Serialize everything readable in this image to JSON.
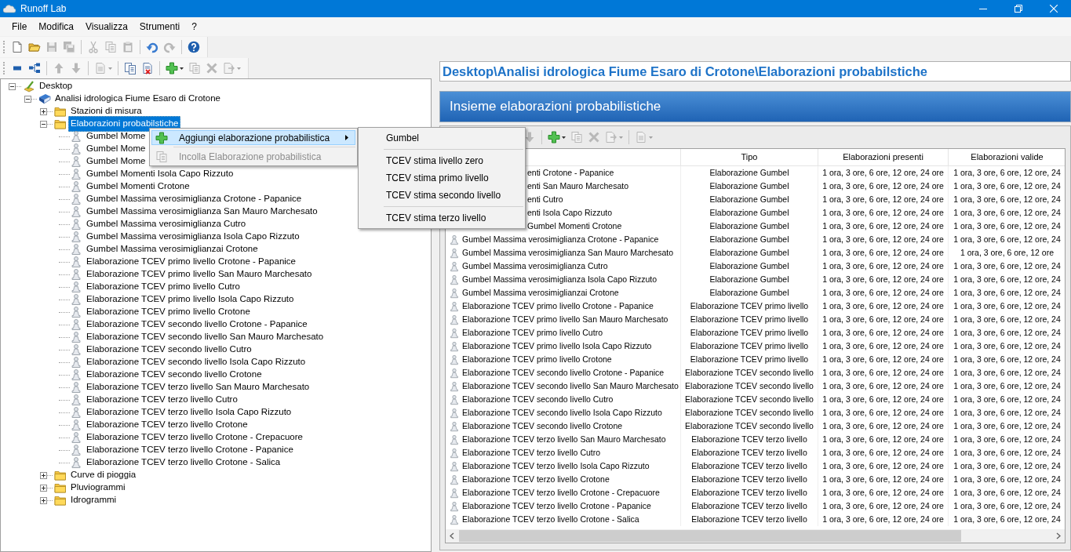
{
  "window": {
    "title": "Runoff Lab"
  },
  "menu_bar": [
    "File",
    "Modifica",
    "Visualizza",
    "Strumenti",
    "?"
  ],
  "main_toolbar": [
    {
      "kind": "new",
      "disabled": false
    },
    {
      "kind": "open",
      "disabled": false
    },
    {
      "kind": "save",
      "disabled": true
    },
    {
      "kind": "saveall",
      "disabled": true
    },
    {
      "kind": "separator"
    },
    {
      "kind": "cut",
      "disabled": true
    },
    {
      "kind": "copy",
      "disabled": true
    },
    {
      "kind": "paste",
      "disabled": true
    },
    {
      "kind": "separator"
    },
    {
      "kind": "undo",
      "disabled": false
    },
    {
      "kind": "redo",
      "disabled": true
    },
    {
      "kind": "separator"
    },
    {
      "kind": "help",
      "disabled": false
    }
  ],
  "tree_toolbar": [
    {
      "kind": "rect",
      "disabled": false
    },
    {
      "kind": "tree",
      "disabled": false
    },
    {
      "kind": "separator"
    },
    {
      "kind": "up",
      "disabled": true
    },
    {
      "kind": "down",
      "disabled": true
    },
    {
      "kind": "separator"
    },
    {
      "kind": "doc",
      "disabled": true,
      "dropdown": true
    },
    {
      "kind": "separator"
    },
    {
      "kind": "copydoc",
      "disabled": false
    },
    {
      "kind": "deletedoc",
      "disabled": false
    },
    {
      "kind": "separator"
    },
    {
      "kind": "add",
      "disabled": false,
      "dropdown": true
    },
    {
      "kind": "copy",
      "disabled": true
    },
    {
      "kind": "delete",
      "disabled": true
    },
    {
      "kind": "export",
      "disabled": true,
      "dropdown": true
    }
  ],
  "tree": [
    {
      "label": "Desktop",
      "kind": "desktop",
      "expanded": true,
      "selected": false,
      "children": [
        {
          "label": "Analisi idrologica Fiume Esaro di Crotone",
          "kind": "project",
          "expanded": true,
          "selected": false,
          "children": [
            {
              "label": "Stazioni di misura",
              "kind": "folder",
              "expanded": false,
              "selected": false
            },
            {
              "label": "Elaborazioni probabilstiche",
              "kind": "folder",
              "expanded": true,
              "selected": true,
              "children": [
                {
                  "label": "Gumbel Mome",
                  "kind": "leaf",
                  "selected": false
                },
                {
                  "label": "Gumbel Mome",
                  "kind": "leaf",
                  "selected": false
                },
                {
                  "label": "Gumbel Mome",
                  "kind": "leaf",
                  "selected": false
                },
                {
                  "label": "Gumbel Momenti Isola Capo Rizzuto",
                  "kind": "leaf",
                  "selected": false
                },
                {
                  "label": "Gumbel Momenti Crotone",
                  "kind": "leaf",
                  "selected": false
                },
                {
                  "label": "Gumbel Massima verosimiglianza Crotone - Papanice",
                  "kind": "leaf",
                  "selected": false
                },
                {
                  "label": "Gumbel Massima verosimiglianza San Mauro Marchesato",
                  "kind": "leaf",
                  "selected": false
                },
                {
                  "label": "Gumbel Massima verosimiglianza Cutro",
                  "kind": "leaf",
                  "selected": false
                },
                {
                  "label": "Gumbel Massima verosimiglianza Isola Capo Rizzuto",
                  "kind": "leaf",
                  "selected": false
                },
                {
                  "label": "Gumbel Massima verosimiglianzai Crotone",
                  "kind": "leaf",
                  "selected": false
                },
                {
                  "label": "Elaborazione TCEV primo livello Crotone - Papanice",
                  "kind": "leaf",
                  "selected": false
                },
                {
                  "label": "Elaborazione TCEV primo livello San Mauro Marchesato",
                  "kind": "leaf",
                  "selected": false
                },
                {
                  "label": "Elaborazione TCEV primo livello Cutro",
                  "kind": "leaf",
                  "selected": false
                },
                {
                  "label": "Elaborazione TCEV primo livello Isola Capo Rizzuto",
                  "kind": "leaf",
                  "selected": false
                },
                {
                  "label": "Elaborazione TCEV primo livello Crotone",
                  "kind": "leaf",
                  "selected": false
                },
                {
                  "label": "Elaborazione TCEV secondo livello Crotone - Papanice",
                  "kind": "leaf",
                  "selected": false
                },
                {
                  "label": "Elaborazione TCEV secondo livello San Mauro Marchesato",
                  "kind": "leaf",
                  "selected": false
                },
                {
                  "label": "Elaborazione TCEV secondo livello Cutro",
                  "kind": "leaf",
                  "selected": false
                },
                {
                  "label": "Elaborazione TCEV secondo livello Isola Capo Rizzuto",
                  "kind": "leaf",
                  "selected": false
                },
                {
                  "label": "Elaborazione TCEV secondo livello Crotone",
                  "kind": "leaf",
                  "selected": false
                },
                {
                  "label": "Elaborazione TCEV terzo livello San Mauro Marchesato",
                  "kind": "leaf",
                  "selected": false
                },
                {
                  "label": "Elaborazione TCEV terzo livello Cutro",
                  "kind": "leaf",
                  "selected": false
                },
                {
                  "label": "Elaborazione TCEV terzo livello Isola Capo Rizzuto",
                  "kind": "leaf",
                  "selected": false
                },
                {
                  "label": "Elaborazione TCEV terzo livello Crotone",
                  "kind": "leaf",
                  "selected": false
                },
                {
                  "label": "Elaborazione TCEV terzo livello Crotone - Crepacuore",
                  "kind": "leaf",
                  "selected": false
                },
                {
                  "label": "Elaborazione TCEV terzo livello Crotone - Papanice",
                  "kind": "leaf",
                  "selected": false
                },
                {
                  "label": "Elaborazione TCEV terzo livello Crotone - Salica",
                  "kind": "leaf",
                  "selected": false
                }
              ]
            },
            {
              "label": "Curve di pioggia",
              "kind": "folder",
              "expanded": false,
              "selected": false
            },
            {
              "label": "Pluviogrammi",
              "kind": "folder",
              "expanded": false,
              "selected": false
            },
            {
              "label": "Idrogrammi",
              "kind": "folder",
              "expanded": false,
              "selected": false
            }
          ]
        }
      ]
    }
  ],
  "context_menu": {
    "items": [
      {
        "label": "Aggiungi elaborazione probabilistica",
        "kind": "submenu",
        "selected": true,
        "disabled": false
      },
      {
        "label": "Incolla Elaborazione probabilistica",
        "kind": "paste",
        "selected": false,
        "disabled": true
      }
    ]
  },
  "submenu": {
    "groups": [
      [
        "Gumbel"
      ],
      [
        "TCEV stima livello zero",
        "TCEV stima primo livello",
        "TCEV stima secondo livello"
      ],
      [
        "TCEV stima terzo livello"
      ]
    ]
  },
  "path_bar": {
    "text": "Desktop\\Analisi idrologica Fiume Esaro di Crotone\\Elaborazioni probabilstiche"
  },
  "panel": {
    "title": "Insieme elaborazioni probabilistiche"
  },
  "panel_toolbar": [
    {
      "kind": "down",
      "disabled": true
    },
    {
      "kind": "separator"
    },
    {
      "kind": "add",
      "disabled": false,
      "dropdown": true
    },
    {
      "kind": "copy",
      "disabled": true
    },
    {
      "kind": "delete",
      "disabled": true
    },
    {
      "kind": "export",
      "disabled": true,
      "dropdown": true
    },
    {
      "kind": "separator"
    },
    {
      "kind": "doc",
      "disabled": true,
      "dropdown": true
    }
  ],
  "table": {
    "headers": [
      "Tipo",
      "Elaborazioni presenti",
      "Elaborazioni valide"
    ],
    "rows": [
      {
        "name": "enti Crotone - Papanice",
        "type": "Elaborazione Gumbel",
        "present": "1 ora, 3 ore, 6 ore, 12 ore, 24 ore",
        "valid": "1 ora, 3 ore, 6 ore, 12 ore, 24"
      },
      {
        "name": "enti San Mauro Marchesato",
        "type": "Elaborazione Gumbel",
        "present": "1 ora, 3 ore, 6 ore, 12 ore, 24 ore",
        "valid": "1 ora, 3 ore, 6 ore, 12 ore, 24"
      },
      {
        "name": "enti Cutro",
        "type": "Elaborazione Gumbel",
        "present": "1 ora, 3 ore, 6 ore, 12 ore, 24 ore",
        "valid": "1 ora, 3 ore, 6 ore, 12 ore, 24"
      },
      {
        "name": "enti Isola Capo Rizzuto",
        "type": "Elaborazione Gumbel",
        "present": "1 ora, 3 ore, 6 ore, 12 ore, 24 ore",
        "valid": "1 ora, 3 ore, 6 ore, 12 ore, 24"
      },
      {
        "name": "Gumbel Momenti Crotone",
        "type": "Elaborazione Gumbel",
        "present": "1 ora, 3 ore, 6 ore, 12 ore, 24 ore",
        "valid": "1 ora, 3 ore, 6 ore, 12 ore, 24"
      },
      {
        "name": "Gumbel Massima verosimiglianza Crotone - Papanice",
        "type": "Elaborazione Gumbel",
        "present": "1 ora, 3 ore, 6 ore, 12 ore, 24 ore",
        "valid": "1 ora, 3 ore, 6 ore, 12 ore, 24"
      },
      {
        "name": "Gumbel Massima verosimiglianza San Mauro Marchesato",
        "type": "Elaborazione Gumbel",
        "present": "1 ora, 3 ore, 6 ore, 12 ore, 24 ore",
        "valid": "1 ora, 3 ore, 6 ore, 12 ore"
      },
      {
        "name": "Gumbel Massima verosimiglianza Cutro",
        "type": "Elaborazione Gumbel",
        "present": "1 ora, 3 ore, 6 ore, 12 ore, 24 ore",
        "valid": "1 ora, 3 ore, 6 ore, 12 ore, 24"
      },
      {
        "name": "Gumbel Massima verosimiglianza Isola Capo Rizzuto",
        "type": "Elaborazione Gumbel",
        "present": "1 ora, 3 ore, 6 ore, 12 ore, 24 ore",
        "valid": "1 ora, 3 ore, 6 ore, 12 ore, 24"
      },
      {
        "name": "Gumbel Massima verosimiglianzai Crotone",
        "type": "Elaborazione Gumbel",
        "present": "1 ora, 3 ore, 6 ore, 12 ore, 24 ore",
        "valid": "1 ora, 3 ore, 6 ore, 12 ore, 24"
      },
      {
        "name": "Elaborazione TCEV primo livello Crotone - Papanice",
        "type": "Elaborazione TCEV primo livello",
        "present": "1 ora, 3 ore, 6 ore, 12 ore, 24 ore",
        "valid": "1 ora, 3 ore, 6 ore, 12 ore, 24"
      },
      {
        "name": "Elaborazione TCEV primo livello San Mauro Marchesato",
        "type": "Elaborazione TCEV primo livello",
        "present": "1 ora, 3 ore, 6 ore, 12 ore, 24 ore",
        "valid": "1 ora, 3 ore, 6 ore, 12 ore, 24"
      },
      {
        "name": "Elaborazione TCEV primo livello Cutro",
        "type": "Elaborazione TCEV primo livello",
        "present": "1 ora, 3 ore, 6 ore, 12 ore, 24 ore",
        "valid": "1 ora, 3 ore, 6 ore, 12 ore, 24"
      },
      {
        "name": "Elaborazione TCEV primo livello Isola Capo Rizzuto",
        "type": "Elaborazione TCEV primo livello",
        "present": "1 ora, 3 ore, 6 ore, 12 ore, 24 ore",
        "valid": "1 ora, 3 ore, 6 ore, 12 ore, 24"
      },
      {
        "name": "Elaborazione TCEV primo livello Crotone",
        "type": "Elaborazione TCEV primo livello",
        "present": "1 ora, 3 ore, 6 ore, 12 ore, 24 ore",
        "valid": "1 ora, 3 ore, 6 ore, 12 ore, 24"
      },
      {
        "name": "Elaborazione TCEV secondo livello Crotone - Papanice",
        "type": "Elaborazione TCEV secondo livello",
        "present": "1 ora, 3 ore, 6 ore, 12 ore, 24 ore",
        "valid": "1 ora, 3 ore, 6 ore, 12 ore, 24"
      },
      {
        "name": "Elaborazione TCEV secondo livello San Mauro Marchesato",
        "type": "Elaborazione TCEV secondo livello",
        "present": "1 ora, 3 ore, 6 ore, 12 ore, 24 ore",
        "valid": "1 ora, 3 ore, 6 ore, 12 ore, 24"
      },
      {
        "name": "Elaborazione TCEV secondo livello Cutro",
        "type": "Elaborazione TCEV secondo livello",
        "present": "1 ora, 3 ore, 6 ore, 12 ore, 24 ore",
        "valid": "1 ora, 3 ore, 6 ore, 12 ore, 24"
      },
      {
        "name": "Elaborazione TCEV secondo livello Isola Capo Rizzuto",
        "type": "Elaborazione TCEV secondo livello",
        "present": "1 ora, 3 ore, 6 ore, 12 ore, 24 ore",
        "valid": "1 ora, 3 ore, 6 ore, 12 ore, 24"
      },
      {
        "name": "Elaborazione TCEV secondo livello Crotone",
        "type": "Elaborazione TCEV secondo livello",
        "present": "1 ora, 3 ore, 6 ore, 12 ore, 24 ore",
        "valid": "1 ora, 3 ore, 6 ore, 12 ore, 24"
      },
      {
        "name": "Elaborazione TCEV terzo livello San Mauro Marchesato",
        "type": "Elaborazione TCEV terzo livello",
        "present": "1 ora, 3 ore, 6 ore, 12 ore, 24 ore",
        "valid": "1 ora, 3 ore, 6 ore, 12 ore, 24"
      },
      {
        "name": "Elaborazione TCEV terzo livello Cutro",
        "type": "Elaborazione TCEV terzo livello",
        "present": "1 ora, 3 ore, 6 ore, 12 ore, 24 ore",
        "valid": "1 ora, 3 ore, 6 ore, 12 ore, 24"
      },
      {
        "name": "Elaborazione TCEV terzo livello Isola Capo Rizzuto",
        "type": "Elaborazione TCEV terzo livello",
        "present": "1 ora, 3 ore, 6 ore, 12 ore, 24 ore",
        "valid": "1 ora, 3 ore, 6 ore, 12 ore, 24"
      },
      {
        "name": "Elaborazione TCEV terzo livello Crotone",
        "type": "Elaborazione TCEV terzo livello",
        "present": "1 ora, 3 ore, 6 ore, 12 ore, 24 ore",
        "valid": "1 ora, 3 ore, 6 ore, 12 ore, 24"
      },
      {
        "name": "Elaborazione TCEV terzo livello Crotone - Crepacuore",
        "type": "Elaborazione TCEV terzo livello",
        "present": "1 ora, 3 ore, 6 ore, 12 ore, 24 ore",
        "valid": "1 ora, 3 ore, 6 ore, 12 ore, 24"
      },
      {
        "name": "Elaborazione TCEV terzo livello Crotone - Papanice",
        "type": "Elaborazione TCEV terzo livello",
        "present": "1 ora, 3 ore, 6 ore, 12 ore, 24 ore",
        "valid": "1 ora, 3 ore, 6 ore, 12 ore, 24"
      },
      {
        "name": "Elaborazione TCEV terzo livello Crotone - Salica",
        "type": "Elaborazione TCEV terzo livello",
        "present": "1 ora, 3 ore, 6 ore, 12 ore, 24 ore",
        "valid": "1 ora, 3 ore, 6 ore, 12 ore, 24"
      }
    ]
  }
}
